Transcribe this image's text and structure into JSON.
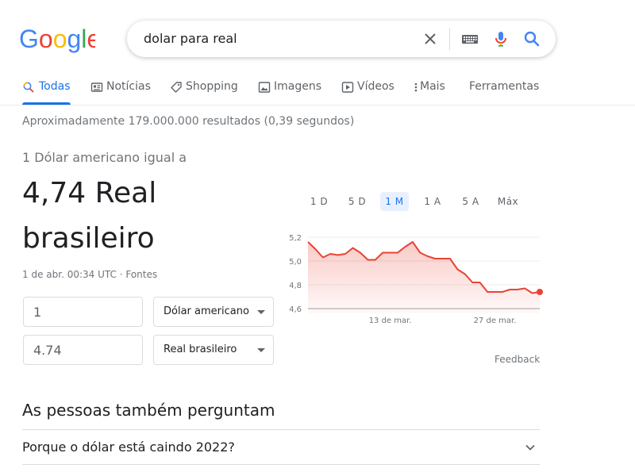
{
  "logo": {
    "text": "Google"
  },
  "search": {
    "query": "dolar para real"
  },
  "icons": {
    "clear": "close-icon",
    "keyboard": "keyboard-icon",
    "voice": "microphone-icon",
    "search": "search-icon"
  },
  "colors": {
    "accent": "#1a73e8",
    "chart_line": "#ea4335",
    "text_secondary": "#70757a"
  },
  "tabs": [
    {
      "label": "Todas",
      "icon": "search-icon",
      "active": true
    },
    {
      "label": "Notícias",
      "icon": "news-icon"
    },
    {
      "label": "Shopping",
      "icon": "tag-icon"
    },
    {
      "label": "Imagens",
      "icon": "image-icon"
    },
    {
      "label": "Vídeos",
      "icon": "play-icon"
    },
    {
      "label": "Mais",
      "icon": "more-icon"
    },
    {
      "label": "Ferramentas"
    }
  ],
  "result_stats": "Aproximadamente 179.000.000 resultados (0,39 segundos)",
  "converter": {
    "label": "1 Dólar americano igual a",
    "value": "4,74 Real brasileiro",
    "date": "1 de abr. 00:34 UTC",
    "separator": " · ",
    "sources_link": "Fontes",
    "from_amount": "1",
    "from_currency": "Dólar americano",
    "to_amount": "4.74",
    "to_currency": "Real brasileiro"
  },
  "ranges": [
    "1 D",
    "5 D",
    "1 M",
    "1 A",
    "5 A",
    "Máx"
  ],
  "active_range": "1 M",
  "chart_data": {
    "type": "area",
    "ylim": [
      4.6,
      5.2
    ],
    "yticks": [
      "5,2",
      "5,0",
      "4,8",
      "4,6"
    ],
    "xticks": [
      "13 de mar.",
      "27 de mar."
    ],
    "values": [
      5.16,
      5.1,
      5.03,
      5.06,
      5.05,
      5.06,
      5.11,
      5.07,
      5.01,
      5.01,
      5.07,
      5.07,
      5.07,
      5.12,
      5.16,
      5.07,
      5.04,
      5.02,
      5.02,
      5.02,
      4.93,
      4.89,
      4.82,
      4.82,
      4.74,
      4.74,
      4.74,
      4.76,
      4.76,
      4.77,
      4.73,
      4.74
    ]
  },
  "feedback": "Feedback",
  "people_also_ask": {
    "title": "As pessoas também perguntam",
    "questions": [
      "Porque o dólar está caindo 2022?"
    ]
  }
}
